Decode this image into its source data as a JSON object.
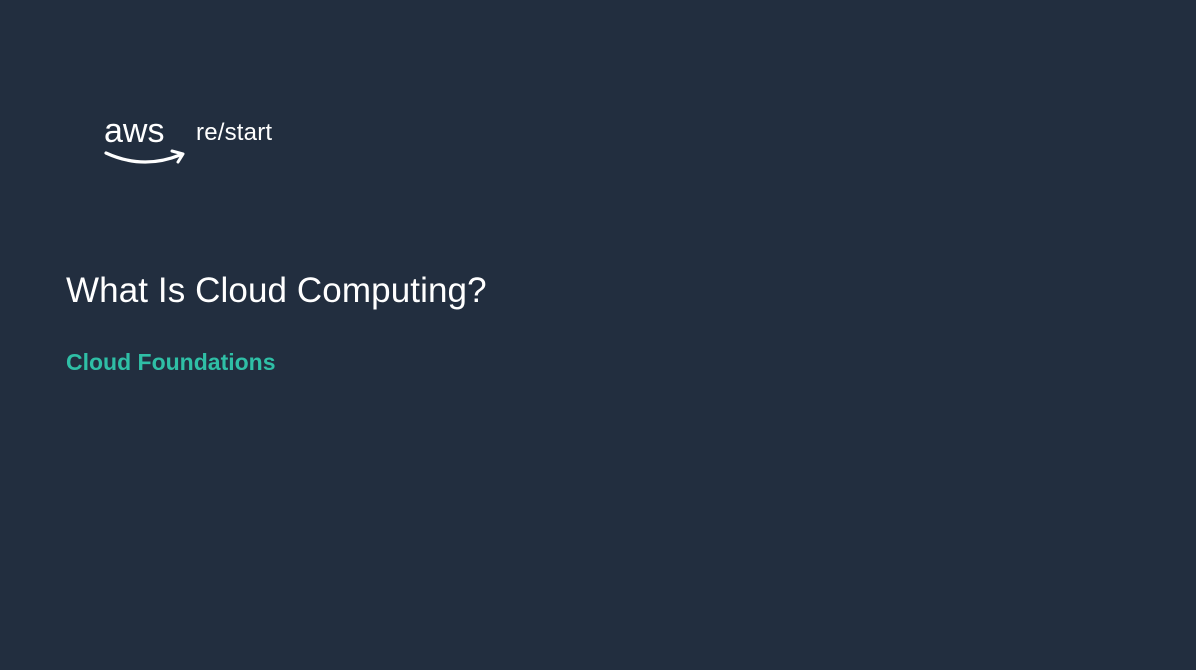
{
  "slide": {
    "logo": {
      "wordmark": "aws",
      "suffix": "re/start",
      "icon": "aws-smile-arrow-icon"
    },
    "title": "What Is Cloud Computing?",
    "subtitle": "Cloud Foundations"
  },
  "colors": {
    "background": "#222e3f",
    "title": "#ffffff",
    "subtitle_accent": "#2fbfa6"
  }
}
